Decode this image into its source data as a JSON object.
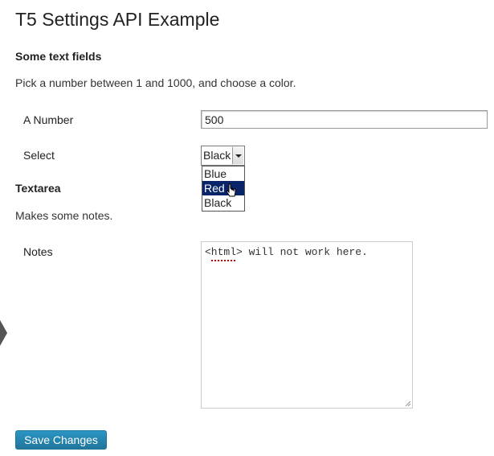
{
  "page": {
    "title": "T5 Settings API Example"
  },
  "section_text": {
    "heading": "Some text fields",
    "description": "Pick a number between 1 and 1000, and choose a color."
  },
  "fields": {
    "number": {
      "label": "A Number",
      "value": "500"
    },
    "select": {
      "label": "Select",
      "value": "Black",
      "options": [
        "Blue",
        "Red",
        "Black"
      ],
      "highlighted_option": "Red"
    }
  },
  "section_textarea": {
    "heading": "Textarea",
    "description": "Makes some notes."
  },
  "notes": {
    "label": "Notes",
    "value": "<html> will not work here."
  },
  "actions": {
    "save_label": "Save Changes"
  },
  "colors": {
    "button_blue": "#21759b",
    "selection_navy": "#0a246a",
    "spellcheck_red": "#cc0000"
  },
  "icons": {
    "cursor": "hand-pointer-icon",
    "resize": "resize-grip-icon",
    "dropdown": "chevron-down-icon"
  }
}
